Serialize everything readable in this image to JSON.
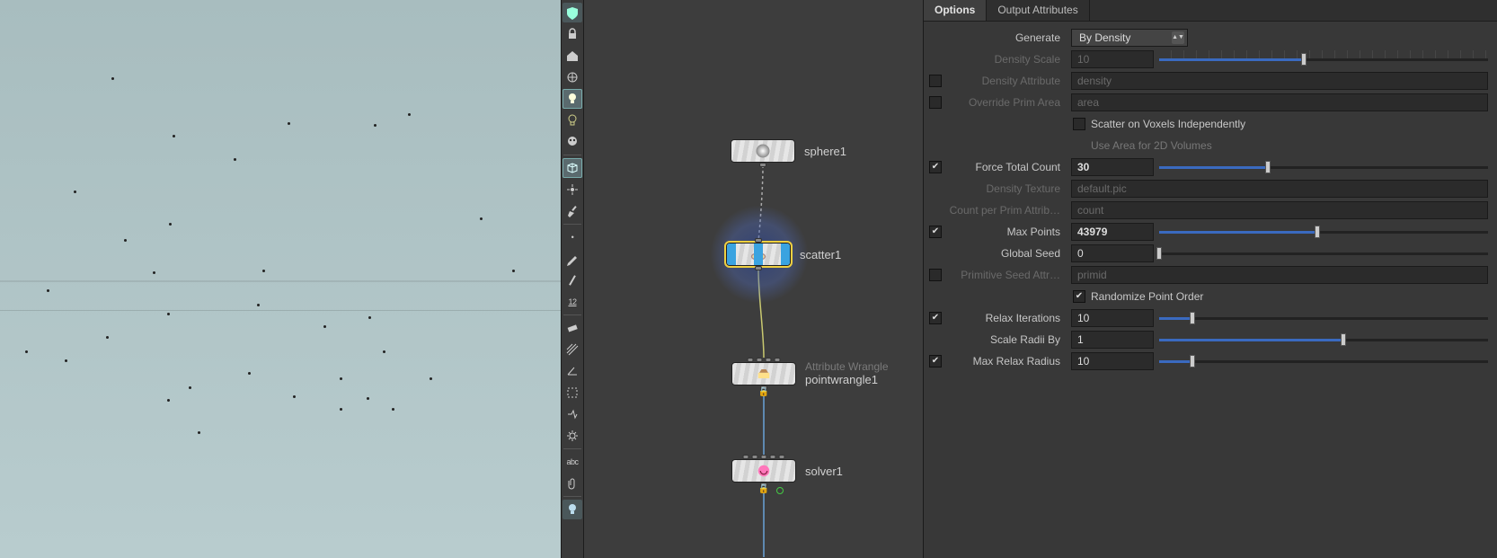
{
  "nodes": {
    "sphere": {
      "label": "sphere1"
    },
    "scatter": {
      "label": "scatter1"
    },
    "wrangle": {
      "type_label": "Attribute Wrangle",
      "label": "pointwrangle1"
    },
    "solver": {
      "label": "solver1"
    }
  },
  "tabs": {
    "options": "Options",
    "output_attrs": "Output Attributes"
  },
  "params": {
    "generate": {
      "label": "Generate",
      "value": "By Density"
    },
    "density_scale": {
      "label": "Density Scale",
      "value": "10"
    },
    "density_attribute": {
      "label": "Density Attribute",
      "value": "density"
    },
    "override_prim_area": {
      "label": "Override Prim Area",
      "value": "area"
    },
    "scatter_voxels": {
      "label": "Scatter on Voxels Independently"
    },
    "use_area_2d": {
      "label": "Use Area for 2D Volumes"
    },
    "force_total_count": {
      "label": "Force Total Count",
      "value": "30",
      "slider_pct": 33
    },
    "density_texture": {
      "label": "Density Texture",
      "value": "default.pic"
    },
    "count_per_prim": {
      "label": "Count per Prim Attrib…",
      "value": "count"
    },
    "max_points": {
      "label": "Max Points",
      "value": "43979",
      "slider_pct": 48
    },
    "global_seed": {
      "label": "Global Seed",
      "value": "0",
      "slider_pct": 0
    },
    "prim_seed_attr": {
      "label": "Primitive Seed Attr…",
      "value": "primid"
    },
    "randomize_order": {
      "label": "Randomize Point Order"
    },
    "relax_iterations": {
      "label": "Relax Iterations",
      "value": "10",
      "slider_pct": 10
    },
    "scale_radii_by": {
      "label": "Scale Radii By",
      "value": "1",
      "slider_pct": 56
    },
    "max_relax_radius": {
      "label": "Max Relax Radius",
      "value": "10",
      "slider_pct": 10
    }
  },
  "toolbar": {
    "abc": "abc",
    "dot": "•",
    "num": "12"
  },
  "scatter_points": [
    [
      124,
      86
    ],
    [
      320,
      136
    ],
    [
      416,
      138
    ],
    [
      454,
      126
    ],
    [
      82,
      212
    ],
    [
      192,
      150
    ],
    [
      260,
      176
    ],
    [
      188,
      248
    ],
    [
      138,
      266
    ],
    [
      170,
      302
    ],
    [
      52,
      322
    ],
    [
      28,
      390
    ],
    [
      72,
      400
    ],
    [
      118,
      374
    ],
    [
      210,
      430
    ],
    [
      186,
      444
    ],
    [
      276,
      414
    ],
    [
      326,
      440
    ],
    [
      378,
      420
    ],
    [
      408,
      442
    ],
    [
      478,
      420
    ],
    [
      426,
      390
    ],
    [
      378,
      454
    ],
    [
      436,
      454
    ],
    [
      360,
      362
    ],
    [
      410,
      352
    ],
    [
      286,
      338
    ],
    [
      186,
      348
    ],
    [
      220,
      480
    ],
    [
      292,
      300
    ],
    [
      570,
      300
    ],
    [
      534,
      242
    ]
  ]
}
